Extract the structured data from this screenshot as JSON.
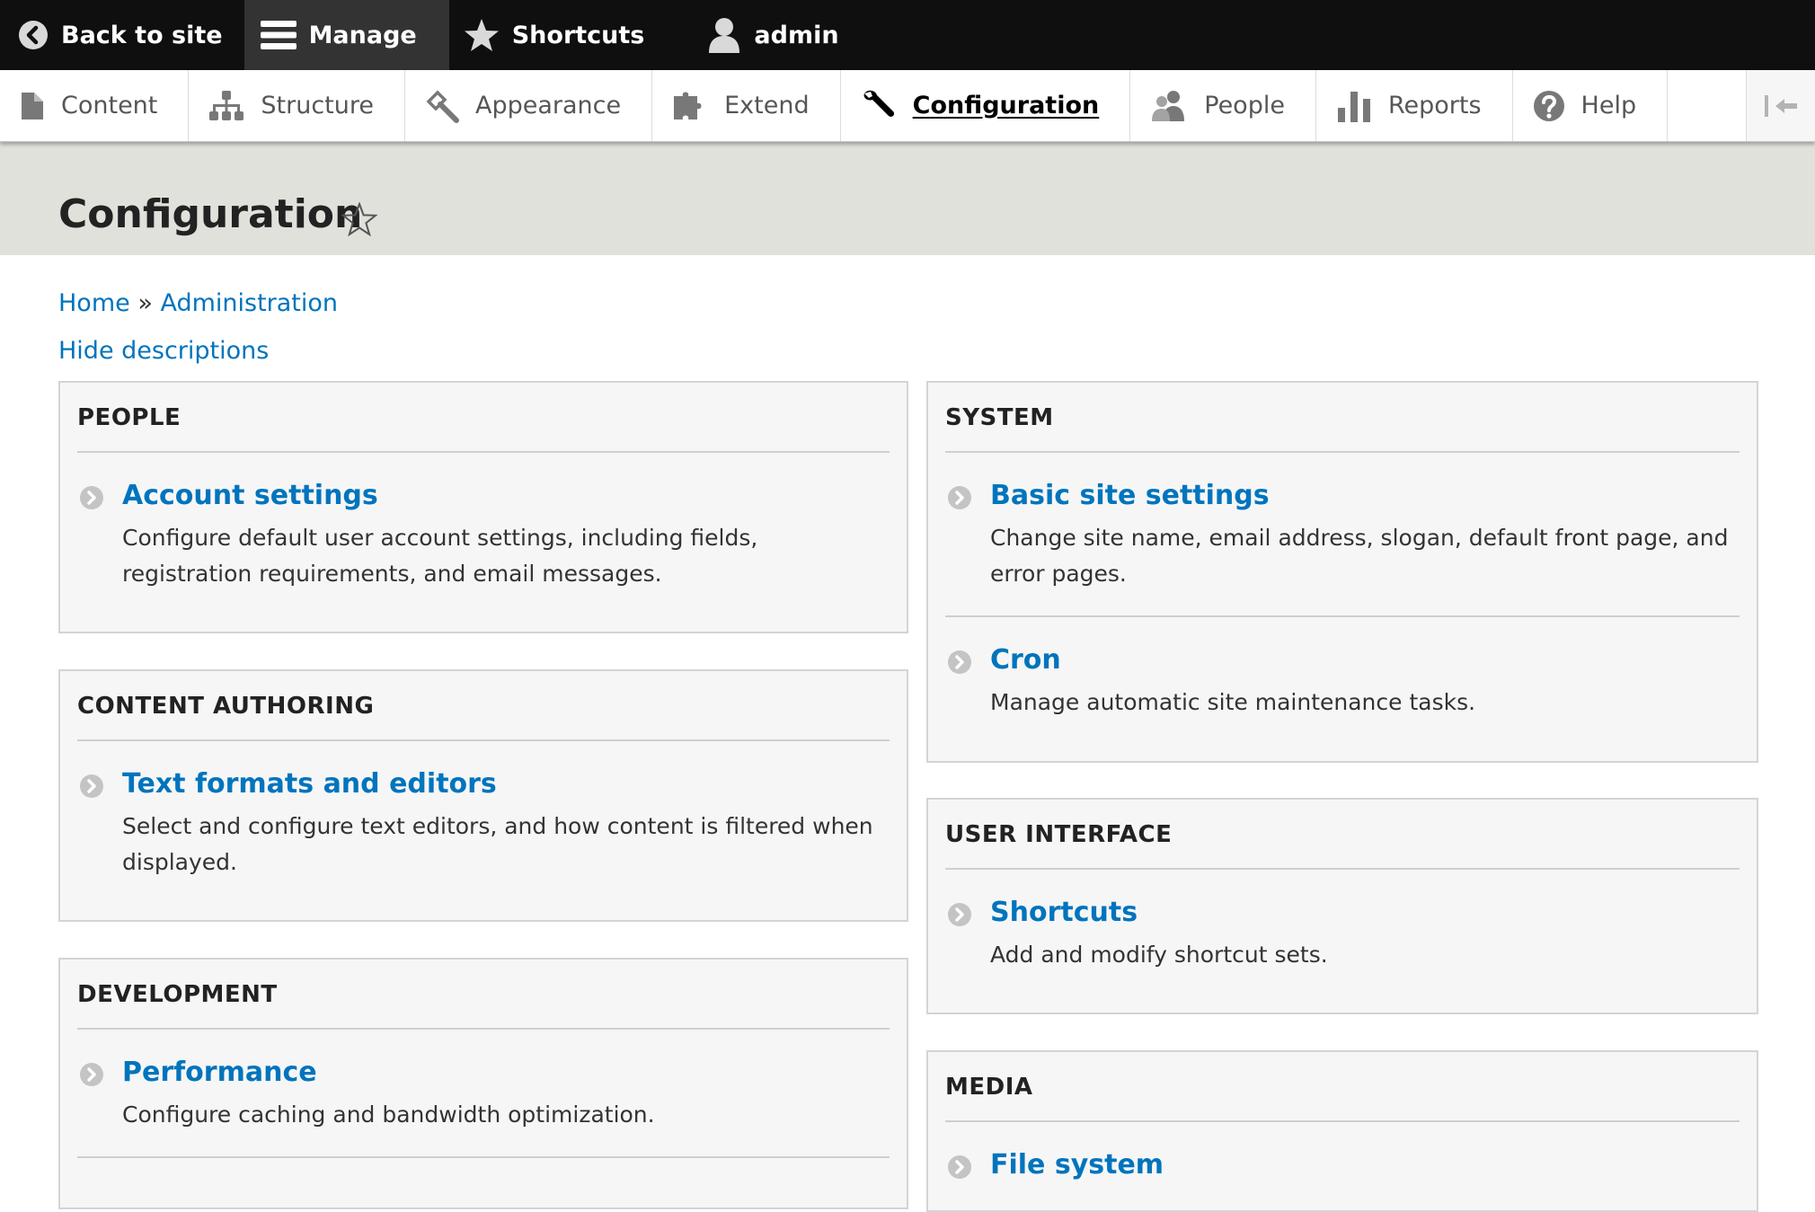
{
  "toolbar": {
    "back_to_site": "Back to site",
    "manage": "Manage",
    "shortcuts": "Shortcuts",
    "user": "admin"
  },
  "tray": {
    "items": [
      {
        "label": "Content",
        "icon": "page-icon"
      },
      {
        "label": "Structure",
        "icon": "structure-icon"
      },
      {
        "label": "Appearance",
        "icon": "paintbrush-icon"
      },
      {
        "label": "Extend",
        "icon": "puzzle-icon"
      },
      {
        "label": "Configuration",
        "icon": "wrench-icon",
        "active": true
      },
      {
        "label": "People",
        "icon": "people-icon"
      },
      {
        "label": "Reports",
        "icon": "bar-chart-icon"
      },
      {
        "label": "Help",
        "icon": "help-icon"
      }
    ]
  },
  "page": {
    "title": "Configuration"
  },
  "breadcrumb": {
    "home": "Home",
    "separator": "»",
    "admin": "Administration"
  },
  "hide_descriptions": "Hide descriptions",
  "panels": {
    "people": {
      "title": "PEOPLE",
      "items": [
        {
          "title": "Account settings",
          "desc": "Configure default user account settings, including fields, registration requirements, and email messages."
        }
      ]
    },
    "content_authoring": {
      "title": "CONTENT AUTHORING",
      "items": [
        {
          "title": "Text formats and editors",
          "desc": "Select and configure text editors, and how content is filtered when displayed."
        }
      ]
    },
    "development": {
      "title": "DEVELOPMENT",
      "items": [
        {
          "title": "Performance",
          "desc": "Configure caching and bandwidth optimization."
        }
      ]
    },
    "system": {
      "title": "SYSTEM",
      "items": [
        {
          "title": "Basic site settings",
          "desc": "Change site name, email address, slogan, default front page, and error pages."
        },
        {
          "title": "Cron",
          "desc": "Manage automatic site maintenance tasks."
        }
      ]
    },
    "user_interface": {
      "title": "USER INTERFACE",
      "items": [
        {
          "title": "Shortcuts",
          "desc": "Add and modify shortcut sets."
        }
      ]
    },
    "media": {
      "title": "MEDIA",
      "items": [
        {
          "title": "File system",
          "desc": ""
        }
      ]
    }
  },
  "colors": {
    "toolbar_bg": "#0f0f0f",
    "toolbar_active": "#333333",
    "header_band": "#e1e1dc",
    "link": "#0074bd",
    "panel_bg": "#f6f6f6"
  }
}
